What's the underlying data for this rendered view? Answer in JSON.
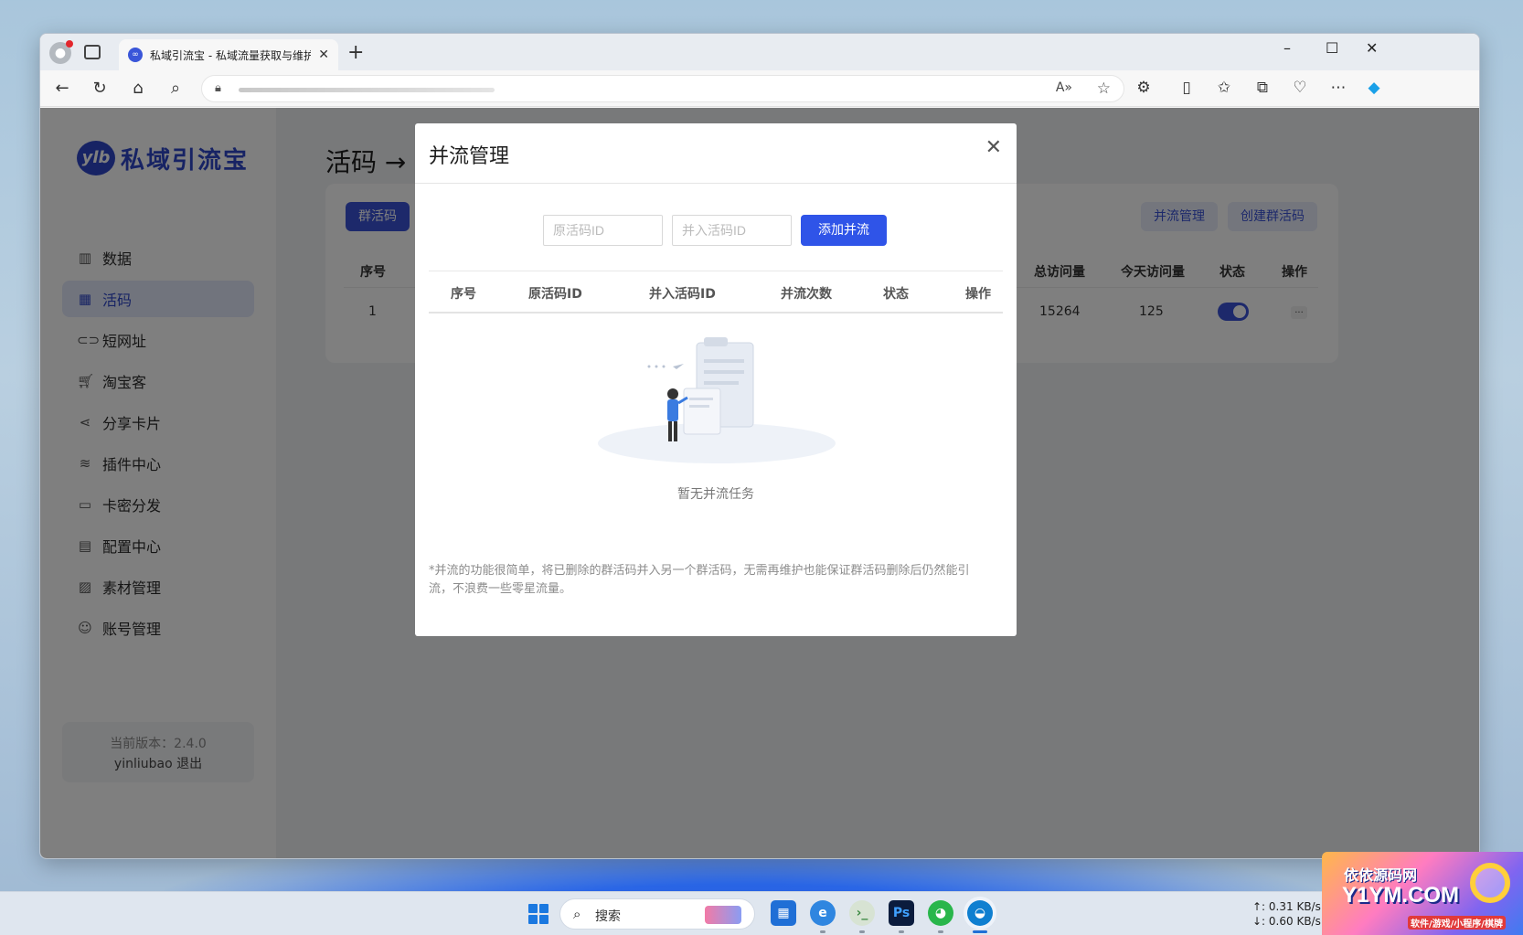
{
  "browser": {
    "tab_title": "私域引流宝 - 私域流量获取与维护",
    "favicon_text": "∞",
    "new_tab": "+",
    "win_minimize": "–",
    "win_maximize": "☐",
    "win_close": "✕"
  },
  "app": {
    "logo_mark": "ylb",
    "logo_name": "私域引流宝",
    "menu": [
      {
        "label": "数据",
        "icon": "chart-icon"
      },
      {
        "label": "活码",
        "icon": "grid-icon"
      },
      {
        "label": "短网址",
        "icon": "link-icon"
      },
      {
        "label": "淘宝客",
        "icon": "cart-icon"
      },
      {
        "label": "分享卡片",
        "icon": "share-icon"
      },
      {
        "label": "插件中心",
        "icon": "layers-icon"
      },
      {
        "label": "卡密分发",
        "icon": "folder-icon"
      },
      {
        "label": "配置中心",
        "icon": "config-icon"
      },
      {
        "label": "素材管理",
        "icon": "image-icon"
      },
      {
        "label": "账号管理",
        "icon": "user-icon"
      }
    ],
    "active_menu": "活码",
    "version_label": "当前版本：2.4.0",
    "username": "yinliubao",
    "logout": "退出"
  },
  "main": {
    "breadcrumb": "活码 →",
    "tab_group": "群活码",
    "btn_merge_manage": "并流管理",
    "btn_create": "创建群活码",
    "table_headers": [
      "序号",
      "总访问量",
      "今天访问量",
      "状态",
      "操作"
    ],
    "rows": [
      {
        "index": "1",
        "total": "15264",
        "today": "125",
        "enabled": true,
        "more": "..."
      }
    ]
  },
  "modal": {
    "title": "并流管理",
    "close": "✕",
    "input_original_placeholder": "原活码ID",
    "input_target_placeholder": "并入活码ID",
    "add_button": "添加并流",
    "columns": [
      "序号",
      "原活码ID",
      "并入活码ID",
      "并流次数",
      "状态",
      "操作"
    ],
    "empty_text": "暂无并流任务",
    "note": "*并流的功能很简单，将已删除的群活码并入另一个群活码，无需再维护也能保证群活码删除后仍然能引流，不浪费一些零星流量。"
  },
  "taskbar": {
    "search_label": "搜索",
    "net_up": "↑: 0.31 KB/s",
    "net_down": "↓: 0.60 KB/s",
    "ps_label": "Ps"
  },
  "watermark": {
    "line1": "依依源码网",
    "line2": "Y1YM.COM",
    "line3": "软件/游戏/小程序/棋牌"
  },
  "colors": {
    "accent": "#2f54e8",
    "brand": "#2e47c9",
    "overlay": "rgba(0,0,0,0.5)"
  }
}
